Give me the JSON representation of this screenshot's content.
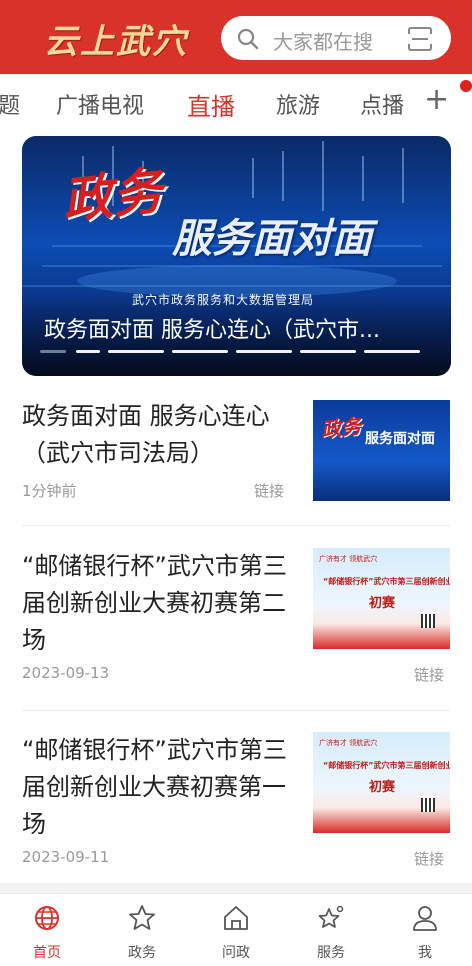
{
  "header": {
    "logo_text": "云上武穴",
    "search_placeholder": "大家都在搜",
    "brand_color": "#d8322a"
  },
  "tabs": {
    "items": [
      {
        "label": "题"
      },
      {
        "label": "广播电视"
      },
      {
        "label": "直播",
        "active": true
      },
      {
        "label": "旅游"
      },
      {
        "label": "点播"
      }
    ],
    "add_label": "+"
  },
  "banner": {
    "hero_line1": "政务",
    "hero_line2": "服务面对面",
    "sub_text": "武穴市政务服务和大数据管理局",
    "caption": "政务面对面 服务心连心（武穴市...",
    "slide_count": 6,
    "active_slide": 1
  },
  "news": [
    {
      "title": "政务面对面 服务心连心（武穴市司法局）",
      "time": "1分钟前",
      "tag": "链接",
      "thumb": {
        "line1": "政务",
        "line2": "服务面对面"
      }
    },
    {
      "title": "“邮储银行杯”武穴市第三届创新创业大赛初赛第二场",
      "time": "2023-09-13",
      "tag": "链接",
      "thumb": {
        "line1": "广济有才 领航武穴",
        "line2": "“邮储银行杯”武穴市第三届创新创业大赛",
        "line3": "初赛"
      }
    },
    {
      "title": "“邮储银行杯”武穴市第三届创新创业大赛初赛第一场",
      "time": "2023-09-11",
      "tag": "链接",
      "thumb": {
        "line1": "广济有才 领航武穴",
        "line2": "“邮储银行杯”武穴市第三届创新创业大赛",
        "line3": "初赛"
      }
    }
  ],
  "bottom_nav": [
    {
      "label": "首页",
      "icon": "globe-icon",
      "active": true
    },
    {
      "label": "政务",
      "icon": "star-icon"
    },
    {
      "label": "问政",
      "icon": "home-icon"
    },
    {
      "label": "服务",
      "icon": "sparkle-star-icon"
    },
    {
      "label": "我",
      "icon": "user-icon"
    }
  ]
}
